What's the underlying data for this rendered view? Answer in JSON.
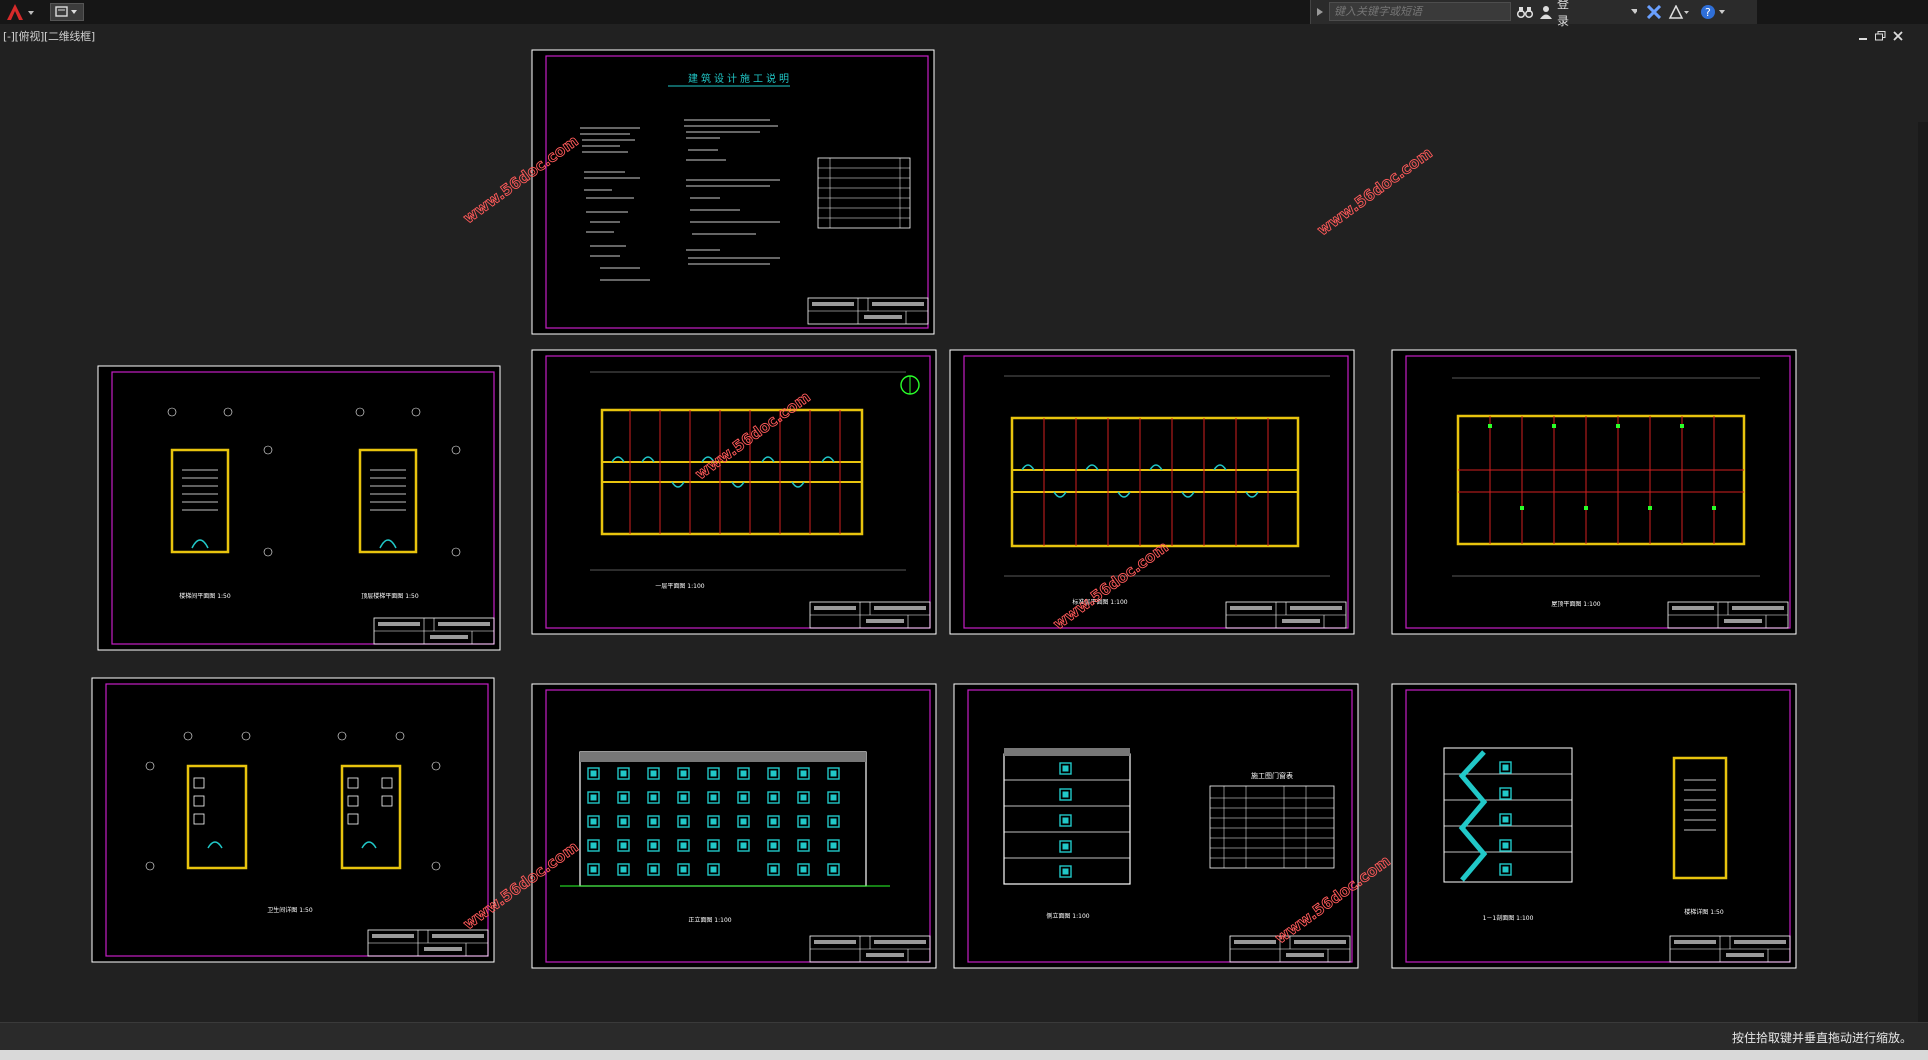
{
  "titlebar": {
    "search_placeholder": "键入关键字或短语",
    "login_label": "登录"
  },
  "viewport_label": "[-][俯视][二维线框]",
  "status_message": "按住拾取键并垂直拖动进行缩放。",
  "sheets": {
    "notes_title": "建筑设计施工说明",
    "door_window_table_title": "施工图门窗表",
    "stair_plan_scale": "楼梯间平面图 1:50",
    "stair_plan_scale_2": "顶层楼梯平面图 1:50",
    "ground_floor_plan": "一层平面图 1:100",
    "typical_floor_plan": "标准层平面图 1:100",
    "roof_plan": "屋顶平面图 1:100",
    "toilet_plan": "卫生间详图 1:50",
    "front_elevation": "正立面图 1:100",
    "side_elevation": "侧立面图 1:100",
    "section": "1－1剖面图 1:100",
    "stair_detail": "楼梯详图 1:50"
  },
  "watermark": "www.56doc.com",
  "colors": {
    "frame": "#c41fc4",
    "sheet_border": "#ffffff",
    "wall": "#e8c40e",
    "axis": "#d21f1f",
    "window": "#21c8c8",
    "watermark": "#ff5a5a"
  }
}
